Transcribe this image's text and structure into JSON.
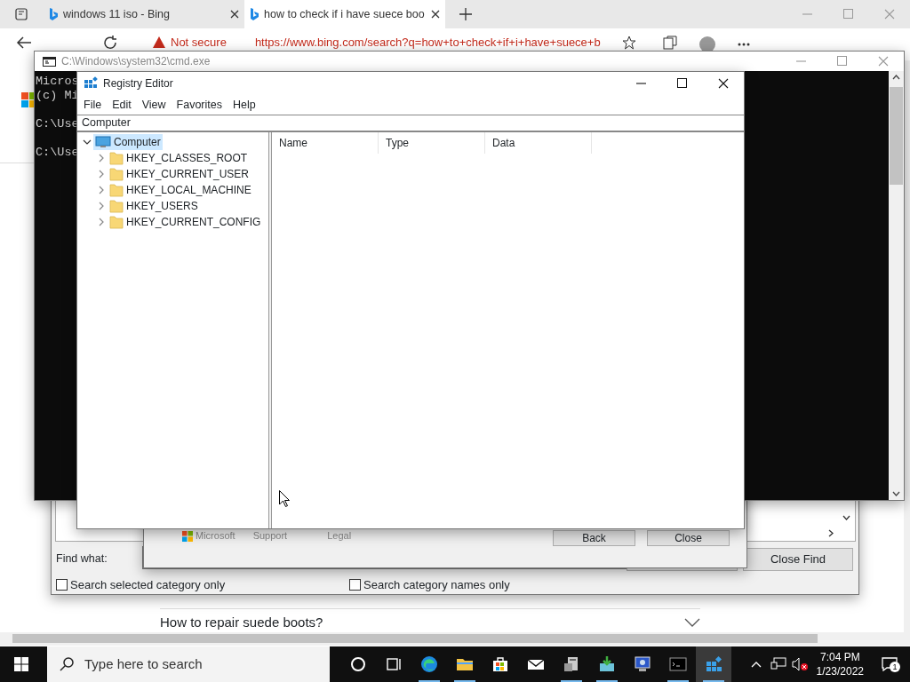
{
  "browser": {
    "tabs": [
      {
        "label": "windows 11 iso - Bing",
        "selected": false
      },
      {
        "label": "how to check if i have suece boo",
        "selected": true
      }
    ],
    "address": {
      "security": "Not secure",
      "url": "https://www.bing.com/search?q=how+to+check+if+i+have+suece+b"
    },
    "questions": [
      {
        "text": "How to repair suede boots?",
        "expanded": false
      }
    ]
  },
  "find_dialog": {
    "label": "Find what:",
    "checkboxes": [
      {
        "label": "Search selected category only",
        "checked": false
      },
      {
        "label": "Search category names only",
        "checked": false
      }
    ],
    "button": "Close Find"
  },
  "help_dialog": {
    "footer_links": [
      "Microsoft",
      "Support",
      "Legal"
    ],
    "buttons": [
      "Back",
      "Close"
    ]
  },
  "cmd": {
    "title": "C:\\Windows\\system32\\cmd.exe",
    "lines": [
      "Micros",
      "(c) Mi",
      "C:\\Use",
      "C:\\Use"
    ]
  },
  "regedit": {
    "title": "Registry Editor",
    "menu": [
      "File",
      "Edit",
      "View",
      "Favorites",
      "Help"
    ],
    "address": "Computer",
    "tree": [
      {
        "label": "Computer",
        "expanded": true,
        "selected": true,
        "children": [
          {
            "label": "HKEY_CLASSES_ROOT",
            "expanded": false,
            "selected": false
          },
          {
            "label": "HKEY_CURRENT_USER",
            "expanded": false,
            "selected": false
          },
          {
            "label": "HKEY_LOCAL_MACHINE",
            "expanded": false,
            "selected": false
          },
          {
            "label": "HKEY_USERS",
            "expanded": false,
            "selected": false
          },
          {
            "label": "HKEY_CURRENT_CONFIG",
            "expanded": false,
            "selected": false
          }
        ]
      }
    ],
    "columns": [
      "Name",
      "Type",
      "Data"
    ]
  },
  "taskbar": {
    "search_placeholder": "Type here to search",
    "apps": [
      {
        "kind": "cortana",
        "running": false,
        "active": false
      },
      {
        "kind": "taskview",
        "running": false,
        "active": false
      },
      {
        "kind": "edge",
        "running": true,
        "active": false
      },
      {
        "kind": "explorer",
        "running": true,
        "active": false
      },
      {
        "kind": "store",
        "running": false,
        "active": false
      },
      {
        "kind": "mail",
        "running": false,
        "active": false
      },
      {
        "kind": "server",
        "running": true,
        "active": false
      },
      {
        "kind": "installer",
        "running": true,
        "active": false
      },
      {
        "kind": "monitor",
        "running": false,
        "active": false
      },
      {
        "kind": "cmd",
        "running": true,
        "active": false
      },
      {
        "kind": "regedit",
        "running": true,
        "active": true
      }
    ],
    "time": "7:04 PM",
    "date": "1/23/2022",
    "notifications": "1"
  }
}
